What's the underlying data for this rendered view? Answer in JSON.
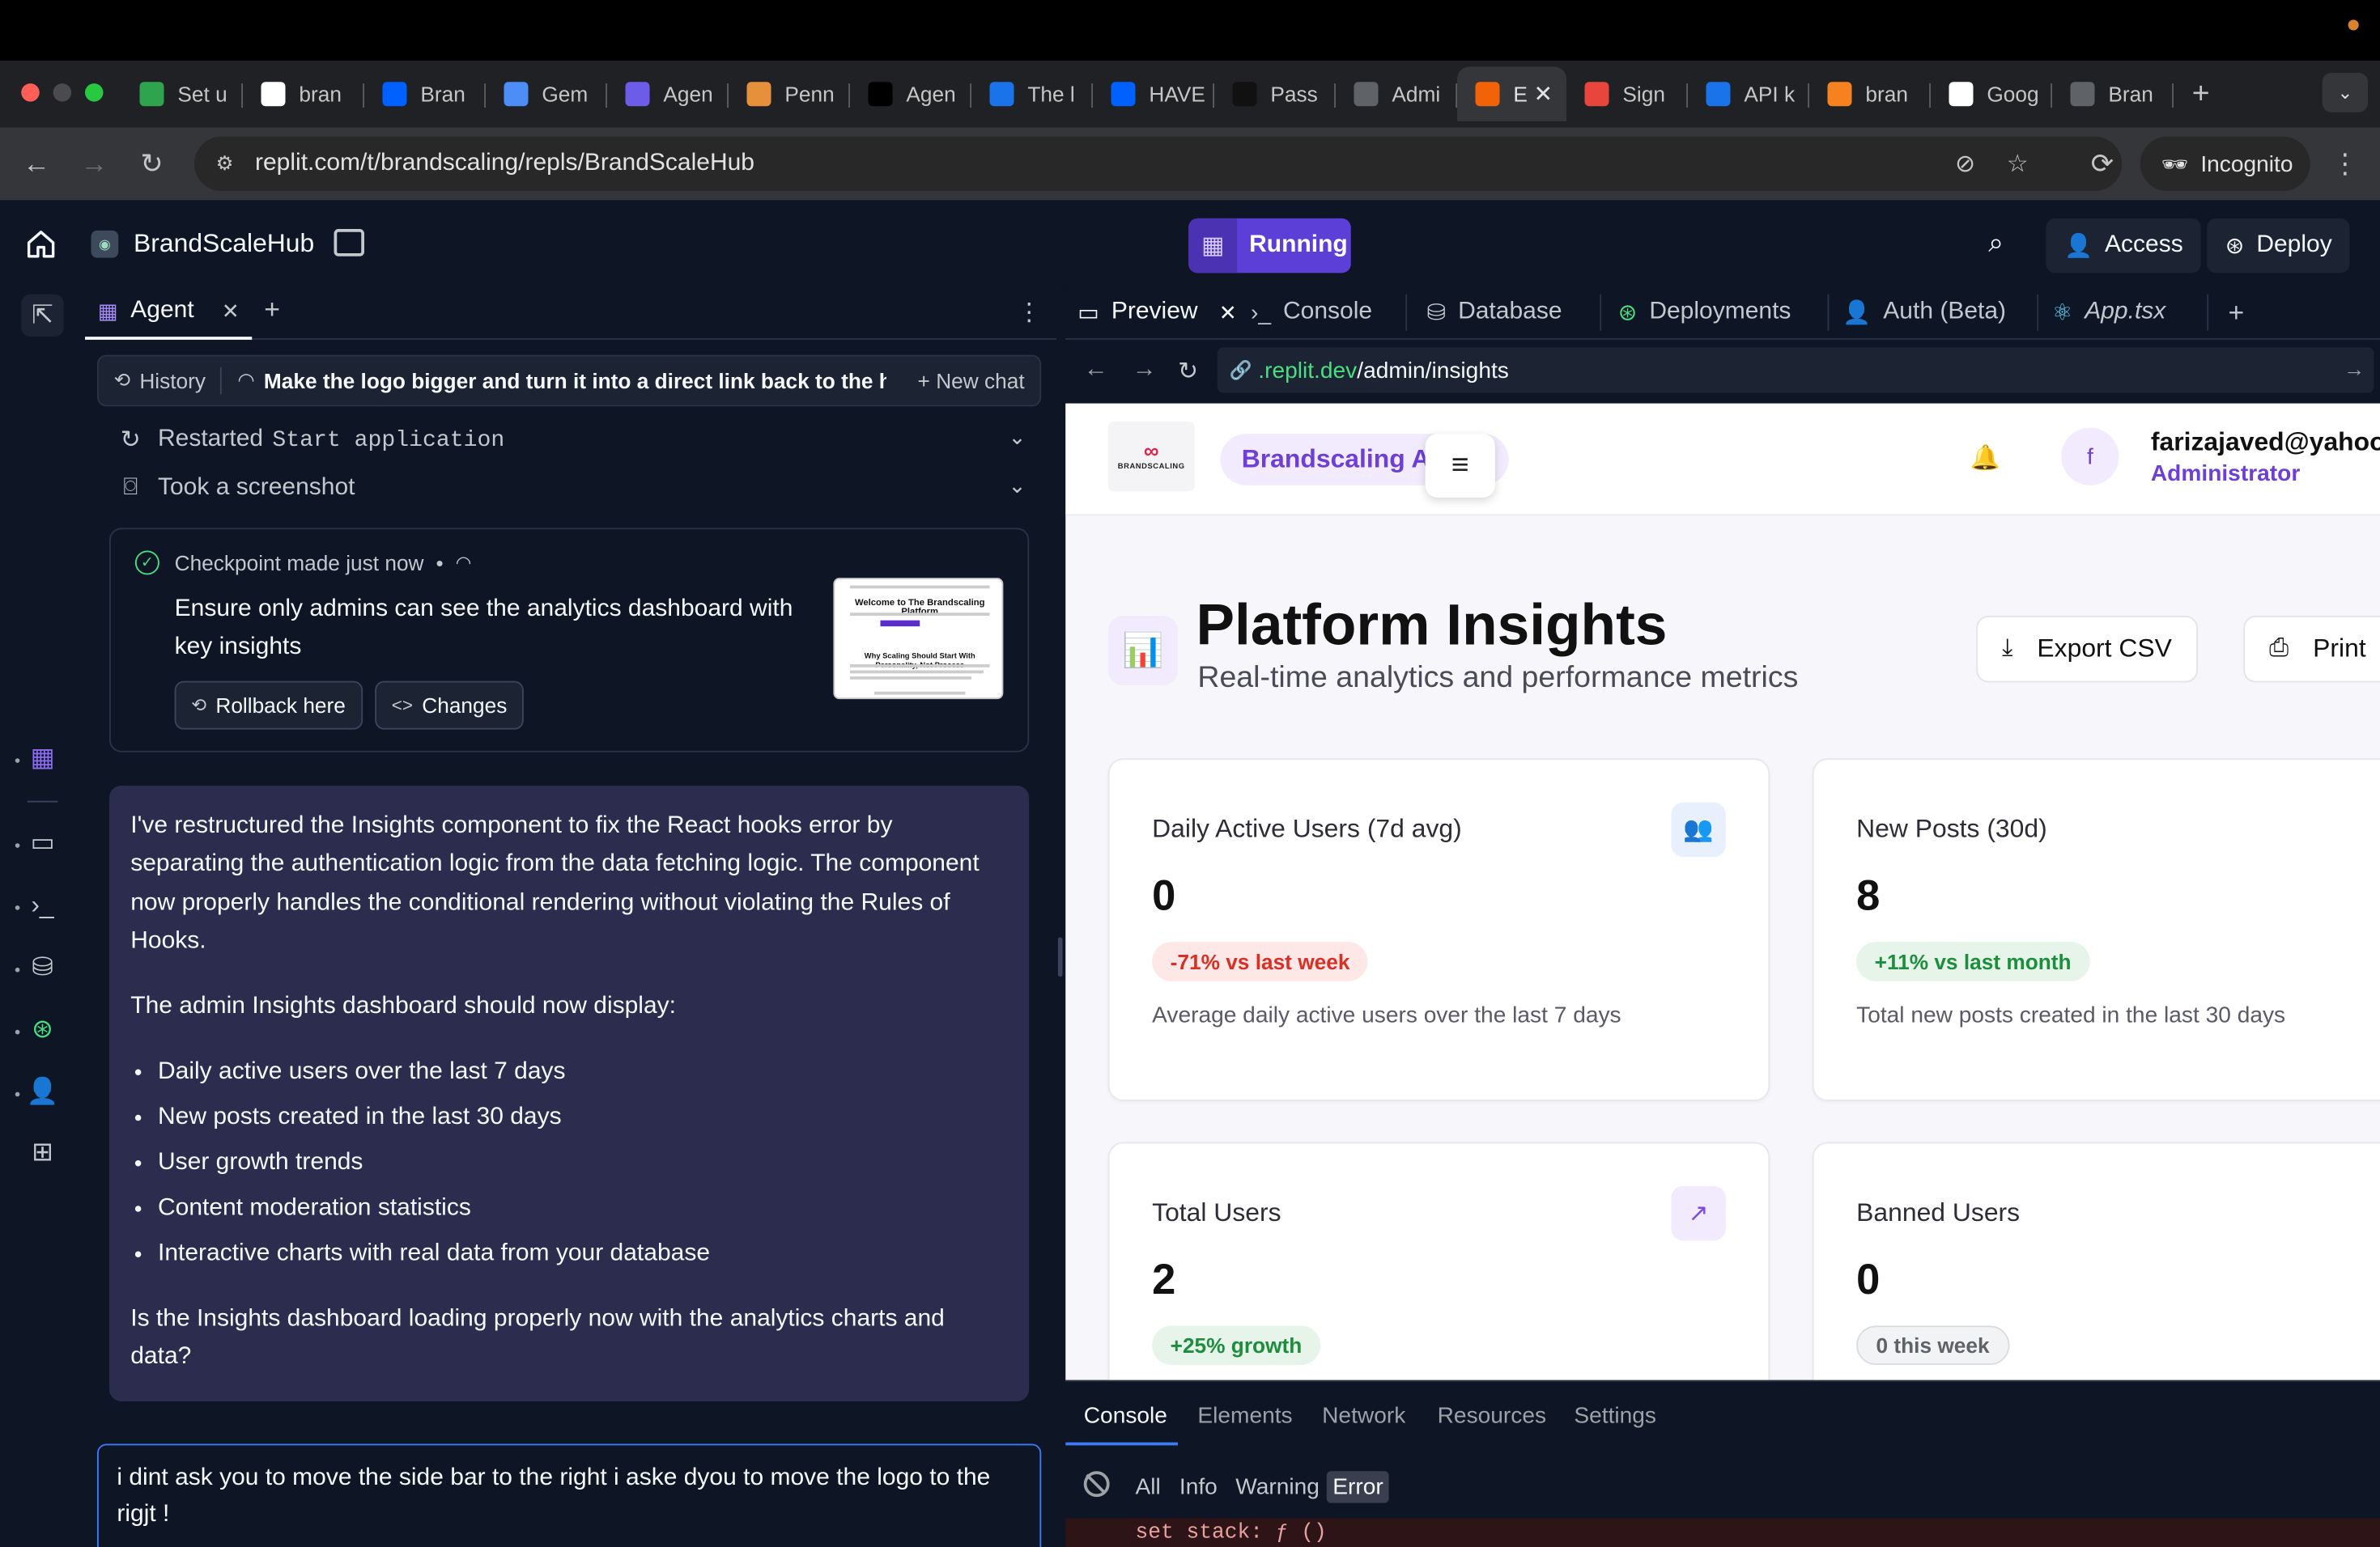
{
  "browser": {
    "tabs": [
      {
        "label": "Set u",
        "favicon": "circle-icon",
        "color": "#2ea44f"
      },
      {
        "label": "bran",
        "favicon": "gmail-icon",
        "color": "#ffffff"
      },
      {
        "label": "Bran",
        "favicon": "dropbox-icon",
        "color": "#0061fe"
      },
      {
        "label": "Gem",
        "favicon": "sparkle-icon",
        "color": "#4c8df6"
      },
      {
        "label": "Agen",
        "favicon": "agent-icon",
        "color": "#6c5ce7"
      },
      {
        "label": "Penn",
        "favicon": "owl-icon",
        "color": "#e6903c"
      },
      {
        "label": "Agen",
        "favicon": "triangle-icon",
        "color": "#000000"
      },
      {
        "label": "The l",
        "favicon": "circle-icon",
        "color": "#1a73e8"
      },
      {
        "label": "HAVE",
        "favicon": "dropbox-icon",
        "color": "#0061fe"
      },
      {
        "label": "Pass",
        "favicon": "upwork-icon",
        "color": "#111111"
      },
      {
        "label": "Admi",
        "favicon": "globe-icon",
        "color": "#5f6368"
      },
      {
        "label": "E",
        "favicon": "replit-icon",
        "color": "#f26207",
        "active": true
      },
      {
        "label": "Sign",
        "favicon": "target-icon",
        "color": "#e8453c"
      },
      {
        "label": "API k",
        "favicon": "openai-icon",
        "color": "#1a73e8"
      },
      {
        "label": "bran",
        "favicon": "fire-icon",
        "color": "#f5821f"
      },
      {
        "label": "Goog",
        "favicon": "google-icon",
        "color": "#ffffff"
      },
      {
        "label": "Bran",
        "favicon": "globe-icon",
        "color": "#5f6368"
      }
    ],
    "url": "replit.com/t/brandscaling/repls/BrandScaleHub",
    "incognito_label": "Incognito"
  },
  "replit": {
    "project_name": "BrandScaleHub",
    "run_status": "Running",
    "access_label": "Access",
    "deploy_label": "Deploy"
  },
  "agent": {
    "tab_label": "Agent",
    "history_label": "History",
    "chat_title": "Make the logo bigger and turn it into a direct link back to the ho...",
    "new_chat_label": "New chat",
    "steps": [
      {
        "prefix": "Restarted",
        "code": "Start application"
      },
      {
        "prefix": "Took a screenshot",
        "code": ""
      }
    ],
    "checkpoint": {
      "meta": "Checkpoint made just now",
      "title": "Ensure only admins can see the analytics dashboard with key insights",
      "rollback_label": "Rollback here",
      "changes_label": "Changes",
      "thumb_title": "Welcome to The Brandscaling Platform",
      "thumb_sub": "Why Scaling Should Start With Personality, Not Process"
    },
    "message": {
      "p1": "I've restructured the Insights component to fix the React hooks error by separating the authentication logic from the data fetching logic. The component now properly handles the conditional rendering without violating the Rules of Hooks.",
      "p2": "The admin Insights dashboard should now display:",
      "bullets": [
        "Daily active users over the last 7 days",
        "New posts created in the last 30 days",
        "User growth trends",
        "Content moderation statistics",
        "Interactive charts with real data from your database"
      ],
      "p3": "Is the Insights dashboard loading properly now with the analytics charts and data?"
    },
    "input_text": "i dint ask you to move the side bar to the right i aske dyou to move the logo to the rigjt !"
  },
  "workspace": {
    "tabs": [
      "Preview",
      "Console",
      "Database",
      "Deployments",
      "Auth (Beta)",
      "App.tsx"
    ],
    "url_host": ".replit.dev",
    "url_path": "/admin/insights"
  },
  "preview": {
    "brand_pill": "Brandscaling A",
    "logo_text": "BRANDSCALING",
    "avatar_letter": "f",
    "email": "farizajaved@yahoo",
    "role": "Administrator",
    "title": "Platform Insights",
    "subtitle": "Real-time analytics and performance metrics",
    "export_label": "Export CSV",
    "print_label": "Print",
    "cards": [
      {
        "label": "Daily Active Users (7d avg)",
        "value": "0",
        "badge": "-71% vs last week",
        "badge_color": "#d93025",
        "desc": "Average daily active users over the last 7 days"
      },
      {
        "label": "New Posts (30d)",
        "value": "8",
        "badge": "+11% vs last month",
        "badge_color": "#1e8e3e",
        "desc": "Total new posts created in the last 30 days"
      },
      {
        "label": "Total Users",
        "value": "2",
        "badge": "+25% growth",
        "badge_color": "#1e8e3e",
        "desc": ""
      },
      {
        "label": "Banned Users",
        "value": "0",
        "badge": "0 this week",
        "badge_color": "#5f6368",
        "desc": ""
      }
    ]
  },
  "devtools": {
    "tabs": [
      "Console",
      "Elements",
      "Network",
      "Resources",
      "Settings"
    ],
    "filters": [
      "All",
      "Info",
      "Warning",
      "Error"
    ],
    "error_line": "set stack: ƒ ()"
  }
}
